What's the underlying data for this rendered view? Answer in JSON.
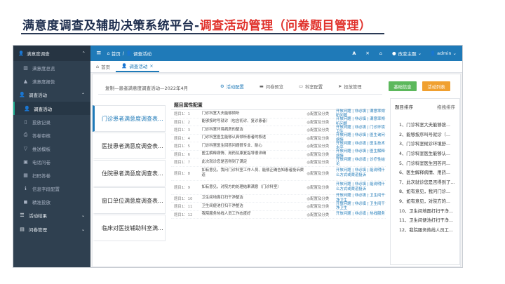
{
  "slide": {
    "title_main": "满意度调查及辅助决策系统平台-",
    "title_highlight": "调查活动管理（问卷题目管理）"
  },
  "sidebar": {
    "app_name": "满意度调查",
    "items": [
      {
        "label": "满意度调查",
        "icon": "user-icon",
        "type": "group"
      },
      {
        "label": "满意度总览",
        "icon": "chart-icon",
        "type": "sub"
      },
      {
        "label": "满意度报告",
        "icon": "report-icon",
        "type": "sub"
      },
      {
        "label": "调查活动",
        "icon": "user-icon",
        "type": "group"
      },
      {
        "label": "调查活动",
        "icon": "user-icon",
        "type": "sub",
        "active": true
      },
      {
        "label": "投放记录",
        "icon": "doc-icon",
        "type": "sub"
      },
      {
        "label": "答卷审核",
        "icon": "print-icon",
        "type": "sub"
      },
      {
        "label": "推送模板",
        "icon": "filter-icon",
        "type": "sub"
      },
      {
        "label": "电话问卷",
        "icon": "phone-icon",
        "type": "sub"
      },
      {
        "label": "扫码答卷",
        "icon": "grid-icon",
        "type": "sub"
      },
      {
        "label": "信息字段配置",
        "icon": "info-icon",
        "type": "sub"
      },
      {
        "label": "精准投放",
        "icon": "target-icon",
        "type": "sub"
      },
      {
        "label": "活动结果",
        "icon": "list-icon",
        "type": "group"
      },
      {
        "label": "问卷管理",
        "icon": "doc-icon",
        "type": "group"
      }
    ]
  },
  "topbar": {
    "menu_icon": "≡",
    "breadcrumb_home": "首页",
    "breadcrumb_current": "调查活动",
    "change_theme": "改变主题",
    "user": "admin"
  },
  "tabs": [
    {
      "label": "首页",
      "active": false
    },
    {
      "label": "调查活动",
      "active": true
    }
  ],
  "content": {
    "breadcrumb": "复制—患者满意度调查活动—2022年4月",
    "steps": [
      "活动配置",
      "问卷预览",
      "科室配置",
      "投放管理"
    ],
    "active_step": 0,
    "btn_basic": "基础信息",
    "btn_activity": "活动列表",
    "questionnaires": [
      "门诊患者满意度调查表...",
      "医技患者满意度调查表...",
      "住院患者满意度调查表...",
      "窗口单位满意度调查表...",
      "临床对医技辅助科室满..."
    ],
    "active_questionnaire": 0,
    "props_title": "题目属性配置",
    "rows": [
      {
        "num": "题目1：1",
        "text": "门诊科室大夫能够倾听",
        "cat": "◎配置及分类",
        "link": "开放问题 | 非必填 | 满意率倾听问题"
      },
      {
        "num": "题目1：2",
        "text": "能够按时号就诊（包含初诊、复诊患者）",
        "cat": "◎配置及分类",
        "link": "开放问题 | 非必填 | 满意率倾听问题"
      },
      {
        "num": "题目1：3",
        "text": "门诊科室环境病房的整洁",
        "cat": "◎配置及分类",
        "link": "开放问题 | 非必填 | 门诊环境卫生"
      },
      {
        "num": "题目1：4",
        "text": "门诊科室医生能够认真倾听患者的叙述",
        "cat": "◎配置及分类",
        "link": "开放问题 | 非必填 | 医生询问病情"
      },
      {
        "num": "题目1：5",
        "text": "门诊科室医生回答问题很专业、耐心",
        "cat": "◎配置及分类",
        "link": "开放问题 | 非必填 | 医生技术水平"
      },
      {
        "num": "题目1：6",
        "text": "医生解释病情、用药及康复指导很详细",
        "cat": "◎配置及分类",
        "link": "开放问题 | 非必填 | 医生解释病情"
      },
      {
        "num": "题目1：7",
        "text": "此次就诊您是否得到了满足",
        "cat": "◎配置及分类",
        "link": "开放问题 | 非必填 | 诊疗性结论"
      },
      {
        "num": "题目1：8",
        "text": "如有意见，我问门诊科室工作人员、能够正确告知患者投诉渠道",
        "cat": "◎配置及分类",
        "link": "开放问题 | 非必填 | 能说明什么方式或渠道投诉",
        "tall": true
      },
      {
        "num": "题目1：9",
        "text": "如有意见，对院方的处理结果满意（门诊科室）",
        "cat": "◎配置及分类",
        "link": "开放问题 | 非必填 | 能说明什么方式或渠道投诉",
        "tall": true
      },
      {
        "num": "题目1：10",
        "text": "卫生间地面打扫干净整洁",
        "cat": "◎配置及分类",
        "link": "开放问题 | 非必填 | 卫生间干净卫生"
      },
      {
        "num": "题目1：11",
        "text": "卫生间便池打扫干净整洁",
        "cat": "◎配置及分类",
        "link": "开放问题 | 非必填 | 卫生间干净卫生"
      },
      {
        "num": "题目1：12",
        "text": "我院服务热线人员工作态度好",
        "cat": "◎配置及分类",
        "link": "开放问题 | 非必填 | 热线服务"
      }
    ],
    "sort_panel": {
      "title": "题目排序",
      "action": "拖拽排序",
      "items": [
        "1、门诊科室大夫能够按...",
        "2、能够按序叫号就诊（...",
        "3、门诊科室候诊环境舒...",
        "4、门诊科室医生能够认...",
        "5、门诊科室医生回答问...",
        "6、医生解释病情、用药...",
        "7、此次就诊您是否得到了...",
        "8、如有意见，我问门诊...",
        "9、如有意见，对院方的...",
        "10、卫生间地面打扫干净...",
        "11、卫生间便池打扫干净...",
        "12、我院服务热线人员工..."
      ]
    }
  },
  "colors": {
    "topbar": "#1f7ab8",
    "sidebar": "#2f4050",
    "accent_green": "#5cb85c",
    "accent_orange": "#f0a030",
    "title_highlight": "#e0312b"
  }
}
